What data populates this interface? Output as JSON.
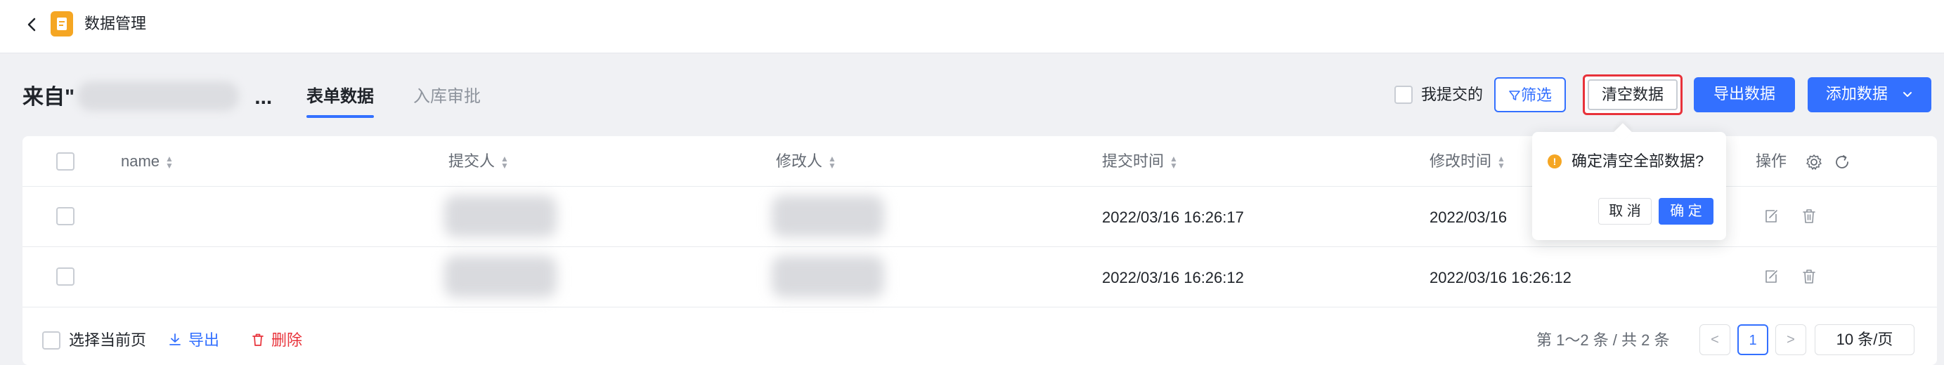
{
  "header": {
    "app_title": "数据管理",
    "back_icon": "chevron-left-icon",
    "app_icon": "document-icon"
  },
  "page": {
    "title": "来自\"",
    "title_suffix": "...",
    "tabs": [
      {
        "label": "表单数据",
        "active": true
      },
      {
        "label": "入库审批",
        "active": false
      }
    ]
  },
  "toolbar": {
    "mine_label": "我提交的",
    "filter_label": "筛选",
    "clear_label": "清空数据",
    "export_label": "导出数据",
    "add_label": "添加数据"
  },
  "table": {
    "columns": [
      "name",
      "提交人",
      "修改人",
      "提交时间",
      "修改时间",
      "操作"
    ],
    "rows": [
      {
        "submit_time": "2022/03/16 16:26:17",
        "modify_time": "2022/03/16 "
      },
      {
        "submit_time": "2022/03/16 16:26:12",
        "modify_time": "2022/03/16 16:26:12"
      }
    ]
  },
  "footer": {
    "select_label": "选择当前页",
    "export_label": "导出",
    "delete_label": "删除"
  },
  "pager": {
    "total_text": "第 1～2 条 / 共 2 条",
    "current_page": "1",
    "prev": "<",
    "next": ">",
    "page_size": "10 条/页"
  },
  "popconfirm": {
    "message": "确定清空全部数据?",
    "cancel": "取 消",
    "ok": "确 定"
  },
  "colors": {
    "primary": "#3370ff",
    "danger": "#e8323a",
    "warning": "#f5a623"
  }
}
